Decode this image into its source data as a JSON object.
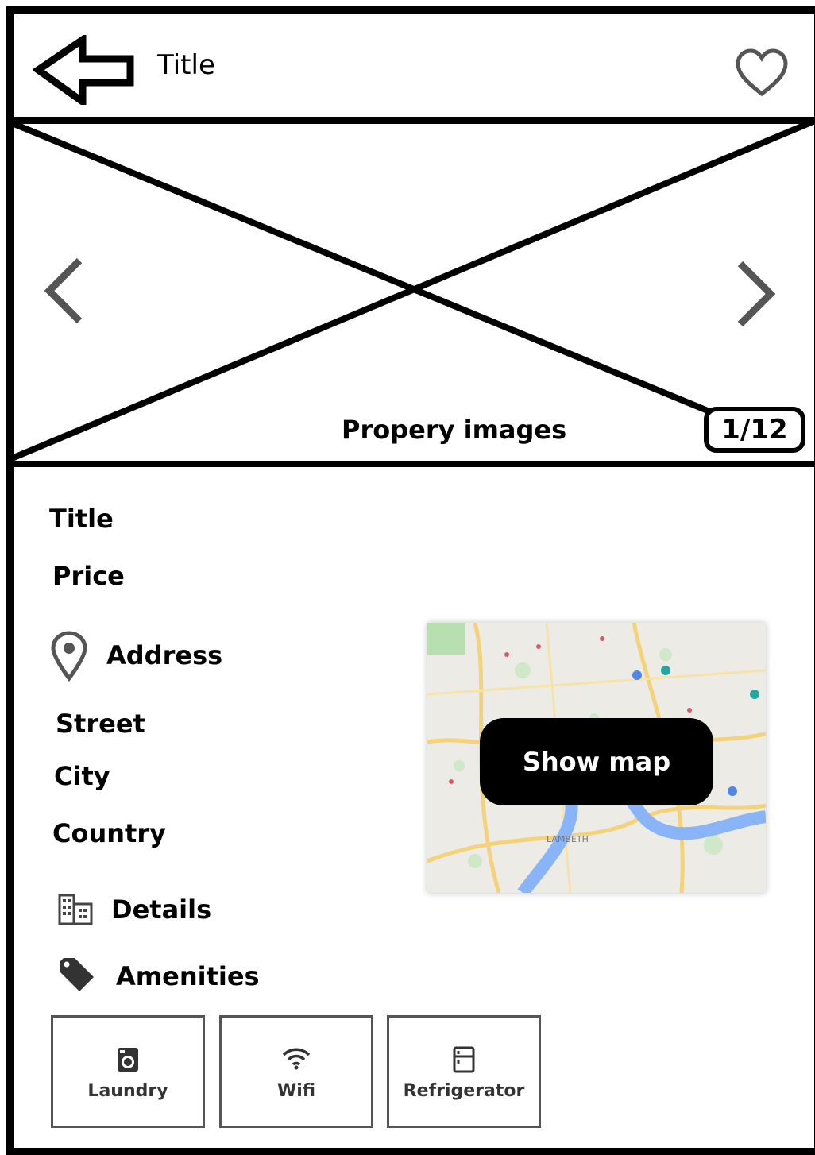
{
  "header": {
    "title": "Title"
  },
  "gallery": {
    "caption": "Propery images",
    "counter": "1/12"
  },
  "listing": {
    "title": "Title",
    "price": "Price"
  },
  "address": {
    "heading": "Address",
    "street": "Street",
    "city": "City",
    "country": "Country",
    "icon": "location-pin-icon"
  },
  "details": {
    "heading": "Details",
    "icon": "building-icon"
  },
  "amenities": {
    "heading": "Amenities",
    "icon": "tag-icon",
    "items": [
      {
        "label": "Laundry",
        "icon": "washing-machine-icon"
      },
      {
        "label": "Wifi",
        "icon": "wifi-icon"
      },
      {
        "label": "Refrigerator",
        "icon": "refrigerator-icon"
      }
    ]
  },
  "map": {
    "button_label": "Show map",
    "place_label": "LAMBETH"
  },
  "colors": {
    "frame": "#000000",
    "chevron": "#555555",
    "map_water": "#8ab4f8",
    "map_park": "#b7dfb0",
    "map_road": "#f3d27a"
  }
}
